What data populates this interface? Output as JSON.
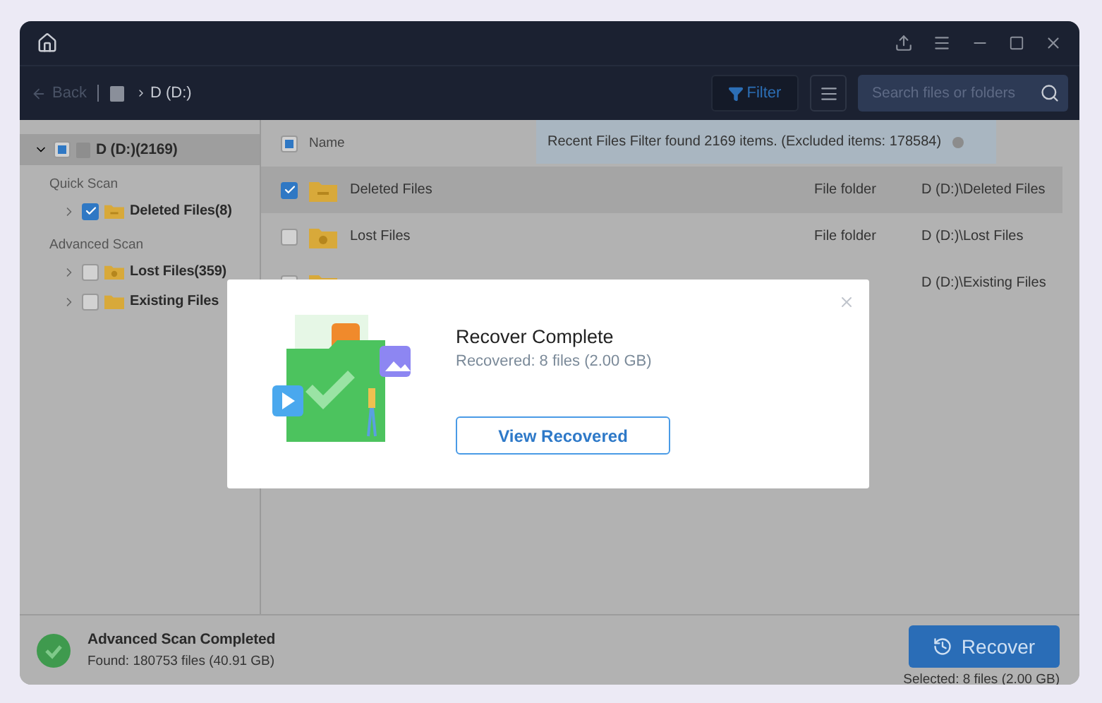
{
  "toolbar": {
    "back": "Back",
    "breadcrumb": "D (D:)",
    "filter": "Filter",
    "search": {
      "placeholder": "Search files or folders"
    }
  },
  "tree": {
    "root": {
      "label": "D (D:)(2169)",
      "partial": true,
      "expanded": true,
      "selected": true
    },
    "groups": [
      {
        "label": "Quick Scan",
        "items": [
          {
            "label": "Deleted Files(8)",
            "checked": true,
            "selected": false,
            "kind": "deleted"
          }
        ]
      },
      {
        "label": "Advanced Scan",
        "items": [
          {
            "label": "Lost Files(359)",
            "checked": false,
            "selected": false,
            "kind": "lost"
          },
          {
            "label": "Existing Files",
            "checked": false,
            "selected": false,
            "kind": "existing"
          }
        ]
      }
    ]
  },
  "table": {
    "header": {
      "label": "Name",
      "partial": true
    },
    "rows": [
      {
        "name": "Deleted Files",
        "type": "File folder",
        "path": "D (D:)\\Deleted Files",
        "checked": true,
        "selected": true,
        "kind": "deleted"
      },
      {
        "name": "Lost Files",
        "type": "File folder",
        "path": "D (D:)\\Lost Files",
        "checked": false,
        "selected": false,
        "kind": "lost"
      },
      {
        "path": "D (D:)\\Existing Files",
        "checked": false,
        "selected": false,
        "kind": "existing"
      }
    ]
  },
  "filter_notice": "Recent Files Filter found 2169 items. (Excluded items: 178584)",
  "dialog": {
    "title": "Recover Complete",
    "subtitle": "Recovered: 8 files (2.00 GB)",
    "button": "View Recovered"
  },
  "footer": {
    "status": "Advanced Scan Completed",
    "found": "Found: 180753 files (40.91 GB)",
    "recover": "Recover",
    "selected": "Selected: 8 files (2.00 GB)"
  }
}
